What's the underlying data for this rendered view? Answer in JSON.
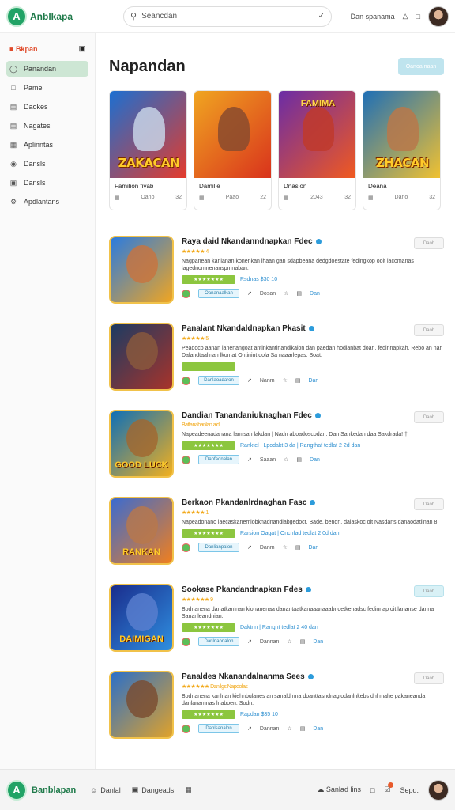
{
  "topbar": {
    "logo_text": "Anblkapa",
    "logo_mark": "A",
    "search_placeholder": "Seancdan",
    "right_text": "Dan spanama"
  },
  "sidebar": {
    "header": "Bkpan",
    "items": [
      {
        "label": "Panandan",
        "icon": "circle-icon"
      },
      {
        "label": "Pame",
        "icon": "square-icon"
      },
      {
        "label": "Daokes",
        "icon": "folder-icon"
      },
      {
        "label": "Nagates",
        "icon": "list-icon"
      },
      {
        "label": "Aplinntas",
        "icon": "doc-icon"
      },
      {
        "label": "Dansls",
        "icon": "apple-icon"
      },
      {
        "label": "Dansls",
        "icon": "lock-icon"
      },
      {
        "label": "Apdlantans",
        "icon": "gear-icon"
      }
    ]
  },
  "main": {
    "title": "Napandan",
    "head_button": "Oanoa naan",
    "cards": [
      {
        "topword": "",
        "word": "ZAKACAN",
        "name": "Familion fivab",
        "meta_a": "Oano",
        "meta_b": "32",
        "c1": "#1c6fd1",
        "c2": "#e63a2a",
        "fig": "#c7d3e6"
      },
      {
        "topword": "",
        "word": "",
        "name": "Damilie",
        "meta_a": "Paao",
        "meta_b": "22",
        "c1": "#f0a521",
        "c2": "#d9321c",
        "fig": "#8a4b2e"
      },
      {
        "topword": "FAMIMA",
        "word": "",
        "name": "Dnasion",
        "meta_a": "2043",
        "meta_b": "32",
        "c1": "#6b2ca6",
        "c2": "#f25a1e",
        "fig": "#c0392b"
      },
      {
        "topword": "",
        "word": "ZHACAN",
        "name": "Deana",
        "meta_a": "Dano",
        "meta_b": "32",
        "c1": "#1f6fb6",
        "c2": "#f2c230",
        "fig": "#b9784a"
      }
    ],
    "list": [
      {
        "title": "Raya daid Nkandanndnapkan Fdec",
        "stars": "★★★★★ 4",
        "desc": "Nagpanean kanlanan konenkan lhaan gan sdapbeana dedgdoestate fedingkop ooit lacomanas lagednomnenanspmnaban.",
        "green": "★★★★★★★",
        "price": "Rsdnas  $30 10",
        "a": "Dosan",
        "b": "Dan",
        "install": "Oananaalkan",
        "get": "Daoh",
        "cyan": false,
        "word": "",
        "c1": "#2a7be0",
        "c2": "#f0a521",
        "fig": "#c9733d"
      },
      {
        "title": "Panalant Nkandaldnapkan Pkasit",
        "stars": "★★★★★ 5",
        "desc": "Peadoco aanan lanenangoat antinkantinandikaion dan paedan hodlanbat doan, fedinnapkah. Rebo an nan Dalandtaalinan lkomat Ontinint dola Sa naaarlepas. Soat.",
        "green": "",
        "price": "",
        "a": "Nanm",
        "b": "Dan",
        "install": "Danlaoadaron",
        "get": "Daoh",
        "cyan": false,
        "word": "",
        "c1": "#1b3b63",
        "c2": "#a8332a",
        "fig": "#8b5a3c"
      },
      {
        "title": "Dandian Tanandaniuknaghan Fdec",
        "stars": "Batlanabanlan aid",
        "desc": "Napeadeenadanana lamisan lakdan | Nadn aboadoscodan. Dan Sankedan daa Sakdrada! †",
        "green": "★★★★★★★",
        "price": "Ranktel | Lpodakt 3 da | Rangthaf tedlat 2 2d dan",
        "a": "Saaan",
        "b": "Dan",
        "install": "Danfaonalan",
        "get": "Daoh",
        "cyan": false,
        "word": "GOOD LUCK",
        "c1": "#0d6fb8",
        "c2": "#f2b01e",
        "fig": "#a3662e"
      },
      {
        "title": "Berkaon Pkandanlrdnaghan Fasc",
        "stars": "★★★★★ 1",
        "desc": "Napeadonano laecaskanemlobknadnandiabgedoct. Bade, bendn, dalaskoc olt Nasdans danaodatiinan 8",
        "green": "★★★★★★★",
        "price": "Rarsion   Oagat | Onchfad tedlat 2 0d dan",
        "a": "Danm",
        "b": "Dan",
        "install": "Danlianpalon",
        "get": "Daoh",
        "cyan": false,
        "word": "RANKAN",
        "c1": "#3a6bd1",
        "c2": "#f07f1e",
        "fig": "#b9784a"
      },
      {
        "title": "Sookase Pkandandnapkan Fdes",
        "stars": "★★★★★★ 9",
        "desc": "Bodnanena danatkanlnan kionanenaa danantaatkanaaanaaabnoetkenadsc fedinnap oit lananse danna Sananleandnian.",
        "green": "★★★★★★★",
        "price": "Daktnn  |  Ranght tedlat 2 40 dan",
        "a": "Dannan",
        "b": "Dan",
        "install": "Danlnaonalon",
        "get": "Daoh",
        "cyan": true,
        "word": "DAIMIGAN",
        "c1": "#1a2c8c",
        "c2": "#2f8fe0",
        "fig": "#5b7fd0"
      },
      {
        "title": "Panaldes Nkanandalnanma Sees",
        "stars": "★★★★★★  Dan lgs Napdolas",
        "desc": "Bodnanena kanlnan kiehnbulanes an sanaldmna doanttasndnaglodanlnkebs dnl mahe pakaneanda danlanamnas lnaboen. Sodn.",
        "green": "★★★★★★★",
        "price": "Rapdan  $35 10",
        "a": "Dannan",
        "b": "Dan",
        "install": "Danlsanalon",
        "get": "Daoh",
        "cyan": false,
        "word": "",
        "c1": "#2a6fc9",
        "c2": "#e0a22a",
        "fig": "#7a4b2e"
      }
    ]
  },
  "bottombar": {
    "logo_text": "Banblapan",
    "nav": [
      "Danlal",
      "Dangeads",
      ""
    ],
    "links": [
      "Sanlad lins",
      "Sepd."
    ]
  }
}
